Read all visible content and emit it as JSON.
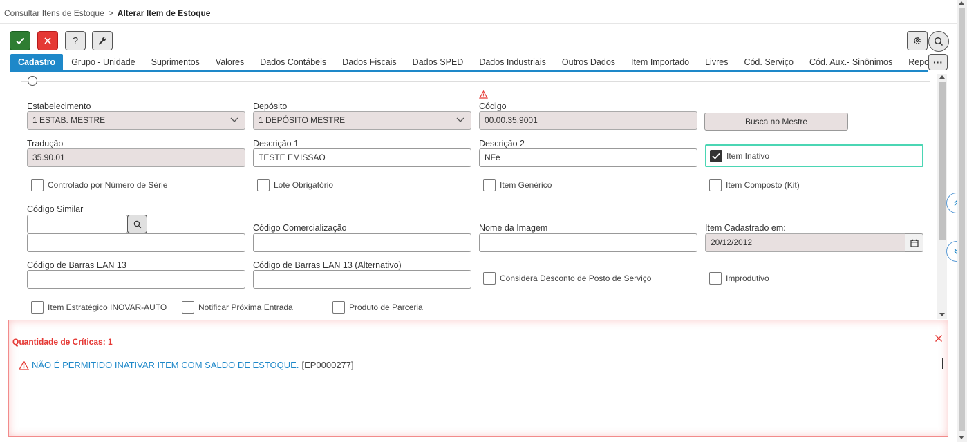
{
  "breadcrumb": {
    "parent": "Consultar Itens de Estoque",
    "separator": ">",
    "current": "Alterar Item de Estoque"
  },
  "toolbar": {
    "help_label": "?"
  },
  "tabs": [
    {
      "label": "Cadastro",
      "active": true
    },
    {
      "label": "Grupo - Unidade"
    },
    {
      "label": "Suprimentos"
    },
    {
      "label": "Valores"
    },
    {
      "label": "Dados Contábeis"
    },
    {
      "label": "Dados Fiscais"
    },
    {
      "label": "Dados SPED"
    },
    {
      "label": "Dados Industriais"
    },
    {
      "label": "Outros Dados"
    },
    {
      "label": "Item Importado"
    },
    {
      "label": "Livres"
    },
    {
      "label": "Cód. Serviço"
    },
    {
      "label": "Cód. Aux.- Sinônimos"
    },
    {
      "label": "Reposição - Preço V"
    }
  ],
  "more_label": "···",
  "form": {
    "estabelecimento": {
      "label": "Estabelecimento",
      "value": "1 ESTAB. MESTRE"
    },
    "deposito": {
      "label": "Depósito",
      "value": "1 DEPÓSITO MESTRE"
    },
    "codigo": {
      "label": "Código",
      "value": "00.00.35.9001"
    },
    "busca_mestre": "Busca no Mestre",
    "traducao": {
      "label": "Tradução",
      "value": "35.90.01"
    },
    "descricao1": {
      "label": "Descrição 1",
      "value": "TESTE EMISSAO"
    },
    "descricao2": {
      "label": "Descrição 2",
      "value": "NFe"
    },
    "item_inativo": {
      "label": "Item Inativo",
      "checked": true
    },
    "controlado_serie": {
      "label": "Controlado por Número de Série",
      "checked": false
    },
    "lote_obrigatorio": {
      "label": "Lote Obrigatório",
      "checked": false
    },
    "item_generico": {
      "label": "Item Genérico",
      "checked": false
    },
    "item_composto": {
      "label": "Item Composto (Kit)",
      "checked": false
    },
    "codigo_similar": {
      "label": "Código Similar",
      "value": ""
    },
    "codigo_comercializacao": {
      "label": "Código Comercialização",
      "value": ""
    },
    "nome_imagem": {
      "label": "Nome da Imagem",
      "value": ""
    },
    "item_cadastrado": {
      "label": "Item Cadastrado em:",
      "value": "20/12/2012"
    },
    "ean13": {
      "label": "Código de Barras EAN 13",
      "value": ""
    },
    "ean13_alt": {
      "label": "Código de Barras EAN 13 (Alternativo)",
      "value": ""
    },
    "considera_desconto": {
      "label": "Considera Desconto de Posto de Serviço",
      "checked": false
    },
    "improdutivo": {
      "label": "Improdutivo",
      "checked": false
    },
    "item_estrategico": {
      "label": "Item Estratégico INOVAR-AUTO",
      "checked": false
    },
    "notificar_entrada": {
      "label": "Notificar Próxima Entrada",
      "checked": false
    },
    "produto_parceria": {
      "label": "Produto de Parceria",
      "checked": false
    }
  },
  "errors": {
    "title": "Quantidade de Críticas: 1",
    "items": [
      {
        "message": "NÃO É PERMITIDO INATIVAR ITEM COM SALDO DE ESTOQUE.",
        "code": "[EP0000277]"
      }
    ]
  },
  "colors": {
    "accent": "#1e88c9",
    "confirm": "#2e7d32",
    "cancel": "#e53935",
    "focus": "#4bd6b4",
    "error": "#e53935"
  }
}
